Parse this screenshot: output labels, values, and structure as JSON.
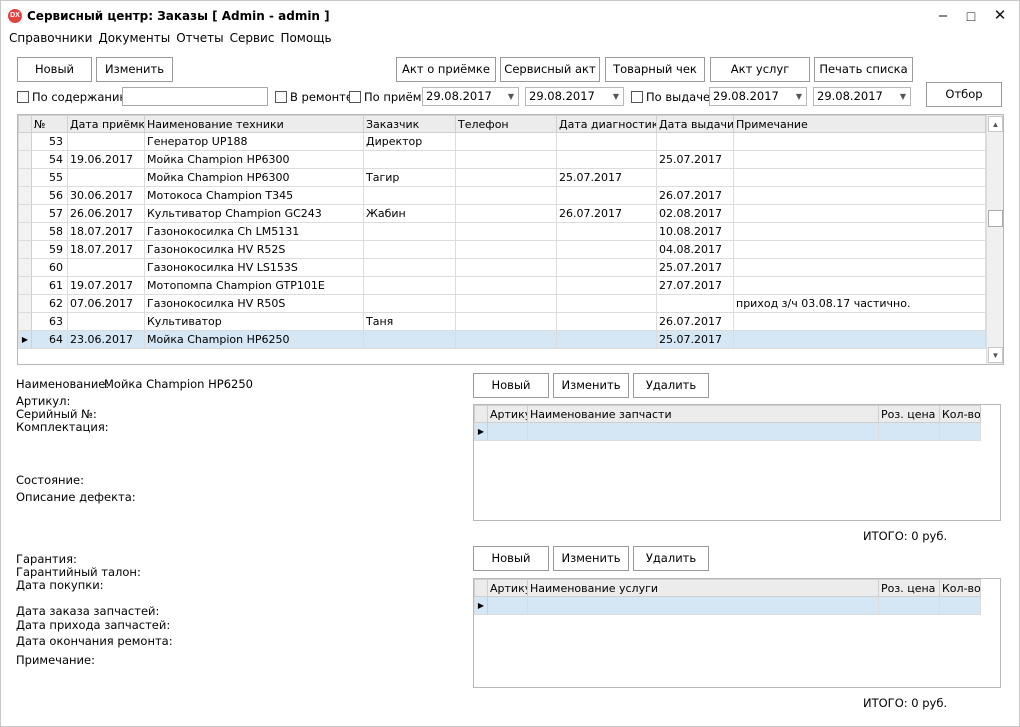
{
  "window": {
    "icon_text": "DX",
    "title": "Сервисный центр: Заказы [ Admin - admin ]"
  },
  "menu": [
    "Справочники",
    "Документы",
    "Отчеты",
    "Сервис",
    "Помощь"
  ],
  "toolbar": {
    "new": "Новый",
    "edit": "Изменить",
    "act_receipt": "Акт о приёмке",
    "service_act": "Сервисный акт",
    "sales_receipt": "Товарный чек",
    "services_act": "Акт услуг",
    "print_list": "Печать списка",
    "filter": "Отбор"
  },
  "filters": {
    "by_content_label": "По содержанию:",
    "by_content_value": "",
    "in_repair_label": "В ремонте",
    "by_receipt_label": "По приёму",
    "receipt_from": "29.08.2017",
    "receipt_to": "29.08.2017",
    "by_issue_label": "По выдаче:",
    "issue_from": "29.08.2017",
    "issue_to": "29.08.2017"
  },
  "orders": {
    "columns": [
      "№",
      "Дата приёмки",
      "Наименование техники",
      "Заказчик",
      "Телефон",
      "Дата диагностики",
      "Дата выдачи",
      "Примечание"
    ],
    "rows": [
      [
        "53",
        "",
        "Генератор UP188",
        "Директор",
        "",
        "",
        "",
        ""
      ],
      [
        "54",
        "19.06.2017",
        "Мойка Champion HP6300",
        "",
        "",
        "",
        "25.07.2017",
        ""
      ],
      [
        "55",
        "",
        "Мойка Champion HP6300",
        "Тагир",
        "",
        "25.07.2017",
        "",
        ""
      ],
      [
        "56",
        "30.06.2017",
        "Мотокоса Champion T345",
        "",
        "",
        "",
        "26.07.2017",
        ""
      ],
      [
        "57",
        "26.06.2017",
        "Культиватор Champion GC243",
        "Жабин",
        "",
        "26.07.2017",
        "02.08.2017",
        ""
      ],
      [
        "58",
        "18.07.2017",
        "Газонокосилка Ch LM5131",
        "",
        "",
        "",
        "10.08.2017",
        ""
      ],
      [
        "59",
        "18.07.2017",
        "Газонокосилка HV R52S",
        "",
        "",
        "",
        "04.08.2017",
        ""
      ],
      [
        "60",
        "",
        "Газонокосилка HV LS153S",
        "",
        "",
        "",
        "25.07.2017",
        ""
      ],
      [
        "61",
        "19.07.2017",
        "Мотопомпа Champion GTP101E",
        "",
        "",
        "",
        "27.07.2017",
        ""
      ],
      [
        "62",
        "07.06.2017",
        "Газонокосилка HV R50S",
        "",
        "",
        "",
        "",
        "приход з/ч 03.08.17 частично."
      ],
      [
        "63",
        "",
        "Культиватор",
        "Таня",
        "",
        "",
        "26.07.2017",
        ""
      ],
      [
        "64",
        "23.06.2017",
        "Мойка Champion HP6250",
        "",
        "",
        "",
        "25.07.2017",
        ""
      ]
    ],
    "selected_row_marker": "▶"
  },
  "details": {
    "name_label": "Наименование:",
    "name_value": "Мойка Champion HP6250",
    "article_label": "Артикул:",
    "serial_label": "Серийный №:",
    "equipment_label": "Комплектация:",
    "condition_label": "Состояние:",
    "defect_label": "Описание дефекта:",
    "warranty_label": "Гарантия:",
    "warranty_card_label": "Гарантийный талон:",
    "purchase_date_label": "Дата покупки:",
    "parts_order_date_label": "Дата заказа запчастей:",
    "parts_arrival_date_label": "Дата прихода запчастей:",
    "repair_end_date_label": "Дата окончания ремонта:",
    "note_label": "Примечание:"
  },
  "parts": {
    "new": "Новый",
    "edit": "Изменить",
    "delete": "Удалить",
    "columns": [
      "Артику",
      "Наименование запчасти",
      "Роз. цена",
      "Кол-во"
    ],
    "total": "ИТОГО: 0 руб."
  },
  "services": {
    "new": "Новый",
    "edit": "Изменить",
    "delete": "Удалить",
    "columns": [
      "Артику",
      "Наименование услуги",
      "Роз. цена",
      "Кол-во"
    ],
    "total": "ИТОГО: 0 руб."
  }
}
